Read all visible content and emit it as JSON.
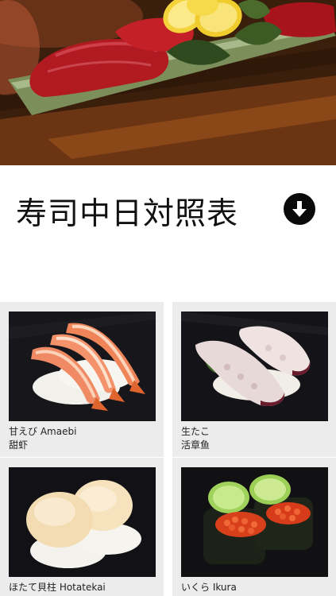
{
  "header": {
    "title": "寿司中日対照表",
    "download_icon": "arrow-down-circle-icon",
    "hero_image": "tuna-nigiri-with-lemon-photo"
  },
  "colors": {
    "title_text": "#111111",
    "card_background": "#ececec",
    "photo_background": "#101014"
  },
  "sushi_items": [
    {
      "jp": "甘えび Amaebi",
      "cn": "甜虾",
      "photo": "amaebi-sweet-shrimp-photo"
    },
    {
      "jp": "生たこ",
      "cn": "活章鱼",
      "photo": "raw-octopus-photo"
    },
    {
      "jp": "ほたて貝柱 Hotatekai",
      "cn": "",
      "photo": "scallop-photo"
    },
    {
      "jp": "いくら Ikura",
      "cn": "",
      "photo": "salmon-roe-gunkan-photo"
    }
  ]
}
